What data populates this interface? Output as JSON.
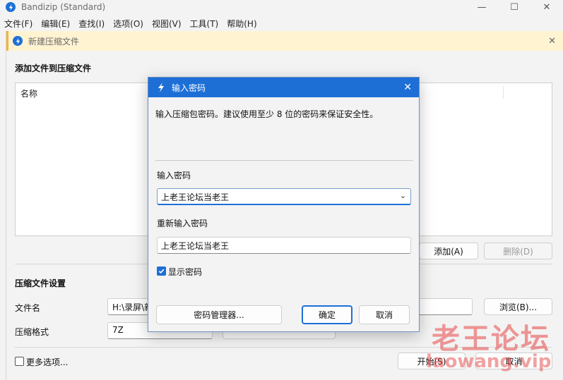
{
  "app": {
    "title": "Bandizip (Standard)",
    "controls": {
      "minimize": "—",
      "maximize": "☐",
      "close": "✕"
    }
  },
  "menu": [
    "文件(F)",
    "编辑(E)",
    "查找(I)",
    "选项(O)",
    "视图(V)",
    "工具(T)",
    "帮助(H)"
  ],
  "create": {
    "title": "新建压缩文件",
    "add_files_title": "添加文件到压缩文件",
    "column_name": "名称",
    "add_button": "添加(A)",
    "delete_button": "删除(D)",
    "settings_title": "压缩文件设置",
    "filename_label": "文件名",
    "filename_value": "H:\\录屏\\新",
    "browse_button": "浏览(B)...",
    "format_label": "压缩格式",
    "format_value": "7Z",
    "more_options_label": "更多选项...",
    "start_button": "开始(S)",
    "cancel_button": "取消"
  },
  "password_dialog": {
    "title": "输入密码",
    "description": "输入压缩包密码。建议使用至少 8 位的密码来保证安全性。",
    "password_label": "输入密码",
    "password_value": "上老王论坛当老王",
    "reenter_label": "重新输入密码",
    "reenter_value": "上老王论坛当老王",
    "show_password_label": "显示密码",
    "show_password_checked": true,
    "manager_button": "密码管理器...",
    "ok_button": "确定",
    "cancel_button": "取消"
  },
  "watermark": {
    "line1": "老王论坛",
    "line2": "laowang.vip"
  },
  "colors": {
    "accent": "#1d6fd6",
    "banner": "#fff3d1",
    "watermark": "#e64646"
  }
}
